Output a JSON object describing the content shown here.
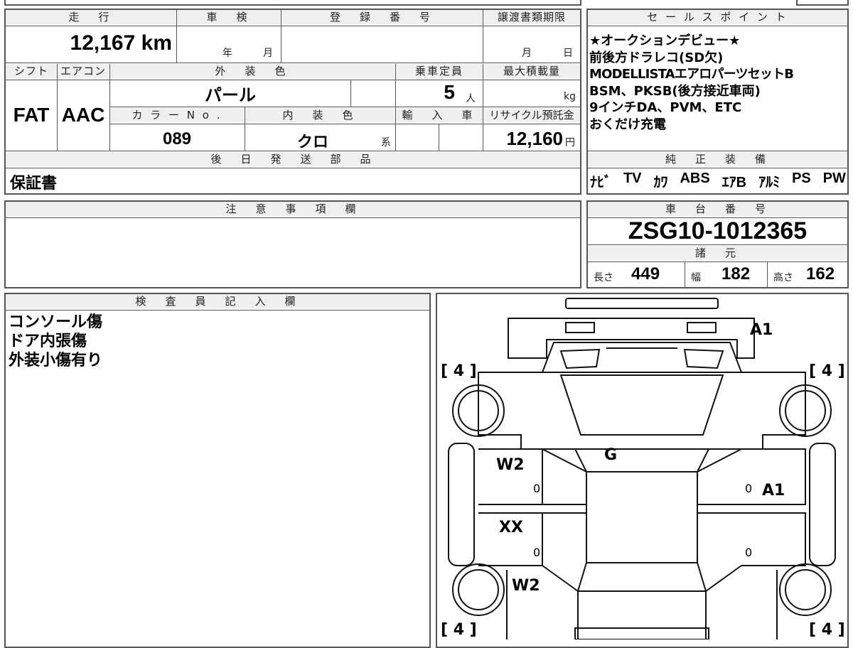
{
  "top": {
    "mileage_header": "走　行",
    "mileage_value": "12,167 km",
    "shaken_header": "車　検",
    "shaken_year": "年",
    "shaken_month": "月",
    "reg_header": "登　録　番　号",
    "transfer_header": "譲渡書類期限",
    "transfer_month": "月",
    "transfer_day": "日"
  },
  "row2": {
    "shift_header": "シフト",
    "ac_header": "エアコン",
    "exterior_header": "外　装　色",
    "capacity_header": "乗車定員",
    "maxload_header": "最大積載量",
    "shift_value": "FAT",
    "ac_value": "AAC",
    "exterior_value": "パール",
    "capacity_value": "5",
    "capacity_unit": "人",
    "maxload_unit": "kg",
    "color_no_header": "カ ラ ー N o .",
    "interior_header": "内　装　色",
    "import_header": "輸　入　車",
    "recycle_header": "リサイクル預託金",
    "color_no_value": "089",
    "interior_value": "クロ",
    "interior_suffix": "系",
    "recycle_value": "12,160",
    "recycle_unit": "円"
  },
  "later_parts": {
    "header": "後　日　発　送　部　品",
    "value": "保証書"
  },
  "sales_points": {
    "header": "セ ー ル ス ポ イ ン ト",
    "lines": [
      "★オークションデビュー★",
      "前後方ドラレコ(SD欠)",
      "MODELLISTAエアロパーツセットB",
      "BSM、PKSB(後方接近車両)",
      "9インチDA、PVM、ETC",
      "おくだけ充電"
    ]
  },
  "equipment": {
    "header": "純　正　装　備",
    "items": [
      "ﾅﾋﾞ",
      "TV",
      "ｶﾜ",
      "ABS",
      "ｴｱB",
      "ｱﾙﾐ",
      "PS",
      "PW"
    ]
  },
  "notes": {
    "header": "注　意　事　項　欄",
    "value": ""
  },
  "chassis": {
    "header": "車　台　番　号",
    "value": "ZSG10-1012365",
    "specs_header": "諸　元",
    "length_label": "長さ",
    "length_value": "449",
    "width_label": "幅",
    "width_value": "182",
    "height_label": "高さ",
    "height_value": "162"
  },
  "inspector": {
    "header": "検　査　員　記　入　欄",
    "lines": [
      "コンソール傷",
      "ドア内張傷",
      "外装小傷有り"
    ]
  },
  "diagram": {
    "tire_front_left": "[ 4 ]",
    "tire_front_right": "[ 4 ]",
    "tire_rear_left": "[ 4 ]",
    "tire_rear_right": "[ 4 ]",
    "mark_front_bumper": "A1",
    "mark_windshield": "G",
    "mark_left_front_door": "W2",
    "mark_left_front_door_sub": "0",
    "mark_right_front_door": "A1",
    "mark_right_front_door_sub": "0",
    "mark_left_rear_door": "XX",
    "mark_left_rear_door_sub": "0",
    "mark_right_rear_door_sub": "0",
    "mark_left_rear_quarter": "W2"
  }
}
